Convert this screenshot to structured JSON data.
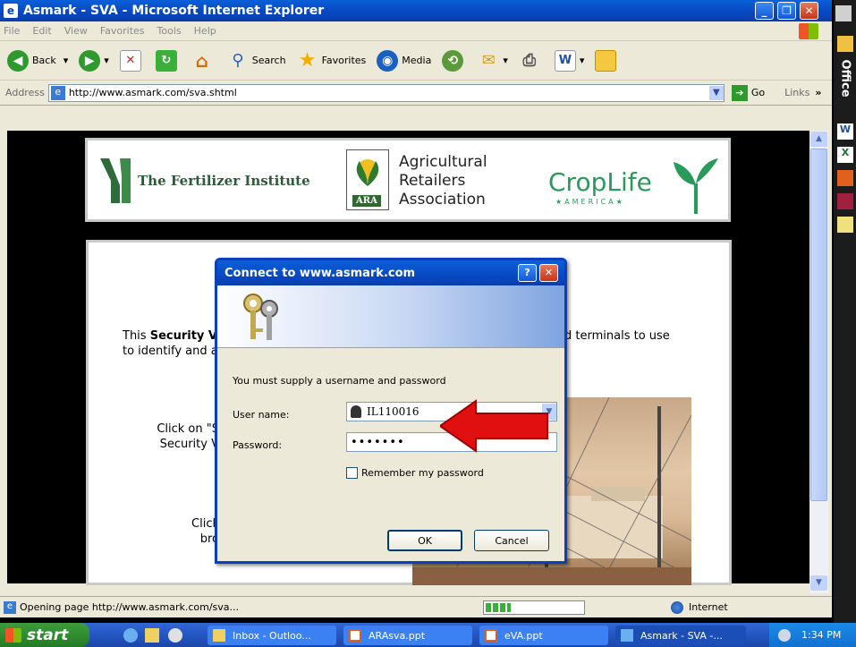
{
  "window": {
    "title": "Asmark - SVA - Microsoft Internet Explorer",
    "min_glyph": "_",
    "max_glyph": "❐",
    "close_glyph": "✕"
  },
  "menu": [
    "File",
    "Edit",
    "View",
    "Favorites",
    "Tools",
    "Help"
  ],
  "toolbar": {
    "back": "Back",
    "search": "Search",
    "favorites": "Favorites",
    "media": "Media"
  },
  "address": {
    "label": "Address",
    "url": "http://www.asmark.com/sva.shtml",
    "go": "Go",
    "links": "Links"
  },
  "logos": {
    "tfi": "The Fertilizer Institute",
    "ara_l1": "Agricultural",
    "ara_l2": "Retailers",
    "ara_l3": "Association",
    "ara_tag": "ARA",
    "croplife": "CropLife",
    "america": "★AMERICA★"
  },
  "page": {
    "para_bold": "Security V",
    "para_pre": "This ",
    "para_l2": "to identify and a",
    "para_right1": "d terminals to use",
    "para_right2": ".",
    "click1a": "Click on \"S",
    "click1b": "Security V",
    "click2a": "Click",
    "click2b": "bro"
  },
  "dialog": {
    "title": "Connect to www.asmark.com",
    "help": "?",
    "close": "✕",
    "message": "You must supply a username and password",
    "user_label": "User name:",
    "user_value": "IL110016",
    "pass_label": "Password:",
    "pass_value": "•••••••",
    "remember": "Remember my password",
    "ok": "OK",
    "cancel": "Cancel"
  },
  "status": {
    "text": "Opening page http://www.asmark.com/sva...",
    "zone": "Internet"
  },
  "taskbar": {
    "start": "start",
    "tasks": [
      "Inbox - Outloo...",
      "ARAsva.ppt",
      "eVA.ppt",
      "Asmark - SVA -..."
    ],
    "time": "1:34 PM"
  },
  "office": {
    "label": "Office"
  },
  "colors": {
    "xp_blue": "#0846c0",
    "arrow_red": "#e01010"
  }
}
